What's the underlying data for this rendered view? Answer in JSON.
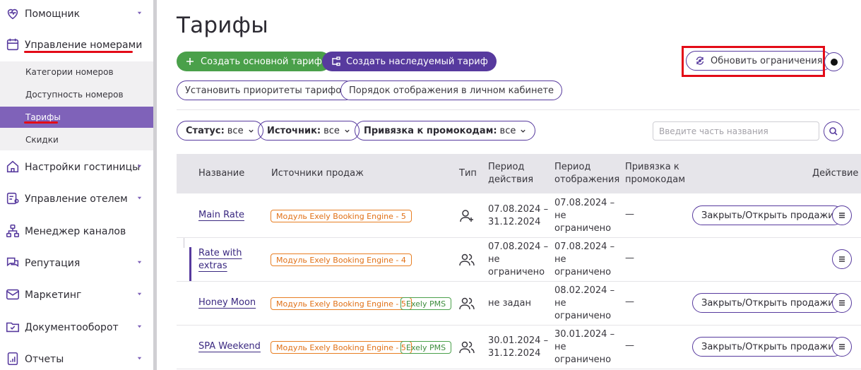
{
  "sidebar": {
    "items": [
      {
        "label": "Помощник",
        "icon": "heart-pulse-icon"
      },
      {
        "label": "Управление номерами",
        "icon": "calendar-icon"
      },
      {
        "label": "Настройки гостиницы",
        "icon": "home-icon"
      },
      {
        "label": "Управление отелем",
        "icon": "clipboard-user-icon"
      },
      {
        "label": "Менеджер каналов",
        "icon": "sitemap-icon"
      },
      {
        "label": "Репутация",
        "icon": "chat-bubbles-icon"
      },
      {
        "label": "Маркетинг",
        "icon": "envelope-icon"
      },
      {
        "label": "Документооборот",
        "icon": "folder-check-icon"
      },
      {
        "label": "Отчеты",
        "icon": "report-icon"
      }
    ],
    "sub_items": [
      {
        "label": "Категории номеров"
      },
      {
        "label": "Доступность номеров"
      },
      {
        "label": "Тарифы"
      },
      {
        "label": "Скидки"
      }
    ]
  },
  "main": {
    "title": "Тарифы",
    "buttons": {
      "create_main": "Создать основной тариф",
      "create_inherited": "Создать наследуемый тариф",
      "update_restrictions": "Обновить ограничения",
      "set_priorities": "Установить приоритеты тарифов",
      "display_order": "Порядок отображения в личном кабинете"
    },
    "filters": {
      "status_label": "Статус:",
      "status_value": "все",
      "source_label": "Источник:",
      "source_value": "все",
      "promo_label": "Привязка к промокодам:",
      "promo_value": "все"
    },
    "search": {
      "placeholder": "Введите часть названия"
    },
    "table": {
      "headers": {
        "name": "Название",
        "sources": "Источники продаж",
        "type": "Тип",
        "period_action_1": "Период",
        "period_action_2": "действия",
        "period_display_1": "Период",
        "period_display_2": "отображения",
        "promo_1": "Привязка к",
        "promo_2": "промокодам",
        "action": "Действие"
      },
      "rows": [
        {
          "name": "Main Rate",
          "tags": [
            "Модуль Exely Booking Engine - 5"
          ],
          "type_icon": "user-plus-icon",
          "period_action": [
            "07.08.2024 –",
            "31.12.2024"
          ],
          "period_display": [
            "07.08.2024 –",
            "не",
            "ограничено"
          ],
          "promo": "—",
          "sale_button": "Закрыть/Открыть продажи"
        },
        {
          "name_1": "Rate with",
          "name_2": "extras",
          "tags": [
            "Модуль Exely Booking Engine - 4"
          ],
          "type_icon": "users-icon",
          "period_action": [
            "07.08.2024 –",
            "не",
            "ограничено"
          ],
          "period_display": [
            "07.08.2024 –",
            "не",
            "ограничено"
          ],
          "promo": "—"
        },
        {
          "name": "Honey Moon",
          "tags": [
            "Модуль Exely Booking Engine - 5",
            "Exely PMS"
          ],
          "type_icon": "users-icon",
          "period_action": [
            "не задан"
          ],
          "period_display": [
            "08.02.2024 –",
            "не",
            "ограничено"
          ],
          "promo": "—",
          "sale_button": "Закрыть/Открыть продажи"
        },
        {
          "name": "SPA Weekend",
          "tags": [
            "Модуль Exely Booking Engine - 5",
            "Exely PMS"
          ],
          "type_icon": "users-icon",
          "period_action": [
            "30.01.2024 –",
            "31.12.2024"
          ],
          "period_display": [
            "30.01.2024 –",
            "не",
            "ограничено"
          ],
          "promo": "—",
          "sale_button": "Закрыть/Открыть продажи"
        }
      ]
    }
  },
  "colors": {
    "accent": "#573a9e",
    "green": "#4aa04a",
    "active_sub": "#7f62b9",
    "highlight": "#e30b17",
    "tag_orange": "#e87e22"
  }
}
